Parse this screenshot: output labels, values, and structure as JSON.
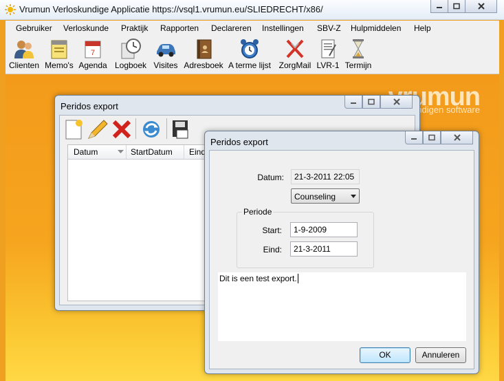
{
  "app": {
    "title": "Vrumun Verloskundige Applicatie https://vsql1.vrumun.eu/SLIEDRECHT/x86/"
  },
  "menu": [
    "Gebruiker",
    "Verloskunde",
    "Praktijk",
    "Rapporten",
    "Declareren",
    "Instellingen",
    "SBV-Z",
    "Hulpmiddelen",
    "Help"
  ],
  "toolbar": [
    {
      "label": "Clienten",
      "icon": "clients-icon"
    },
    {
      "label": "Memo's",
      "icon": "memo-icon"
    },
    {
      "label": "Agenda",
      "icon": "agenda-icon"
    },
    {
      "label": "Logboek",
      "icon": "logbook-icon"
    },
    {
      "label": "Visites",
      "icon": "car-icon"
    },
    {
      "label": "Adresboek",
      "icon": "addressbook-icon"
    },
    {
      "label": "A terme lijst",
      "icon": "alarm-clock-icon"
    },
    {
      "label": "ZorgMail",
      "icon": "zorgmail-icon"
    },
    {
      "label": "LVR-1",
      "icon": "lvr-document-icon"
    },
    {
      "label": "Termijn",
      "icon": "hourglass-icon"
    }
  ],
  "brand": {
    "name": "vrumun",
    "tagline": "kundigen software"
  },
  "list_window": {
    "title": "Peridos export",
    "columns": [
      "Datum",
      "StartDatum",
      "Eind"
    ]
  },
  "dialog": {
    "title": "Peridos export",
    "datum_label": "Datum:",
    "datum_value": "21-3-2011 22:05",
    "type_value": "Counseling",
    "periode_label": "Periode",
    "start_label": "Start:",
    "start_value": "1-9-2009",
    "eind_label": "Eind:",
    "eind_value": "21-3-2011",
    "note": "Dit is een test export.",
    "ok_label": "OK",
    "cancel_label": "Annuleren"
  },
  "colors": {
    "desktop": "#f39a1b",
    "accent": "#3c7fb1"
  }
}
